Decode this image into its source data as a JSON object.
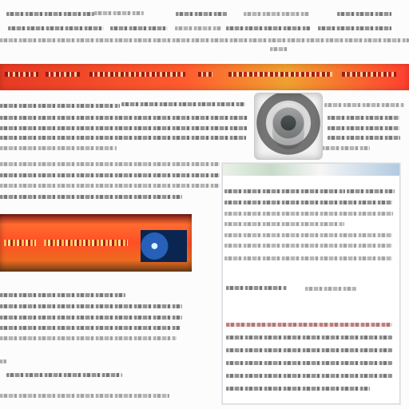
{
  "page": {
    "background_color": "#fcfcfc"
  },
  "regions": {
    "top_banner_color": "#ff4a2a",
    "ad_box_color": "#ff5a2a",
    "image_thumb_icon": "camera-lens-icon",
    "sidebar_panel_color": "#ffffff"
  }
}
